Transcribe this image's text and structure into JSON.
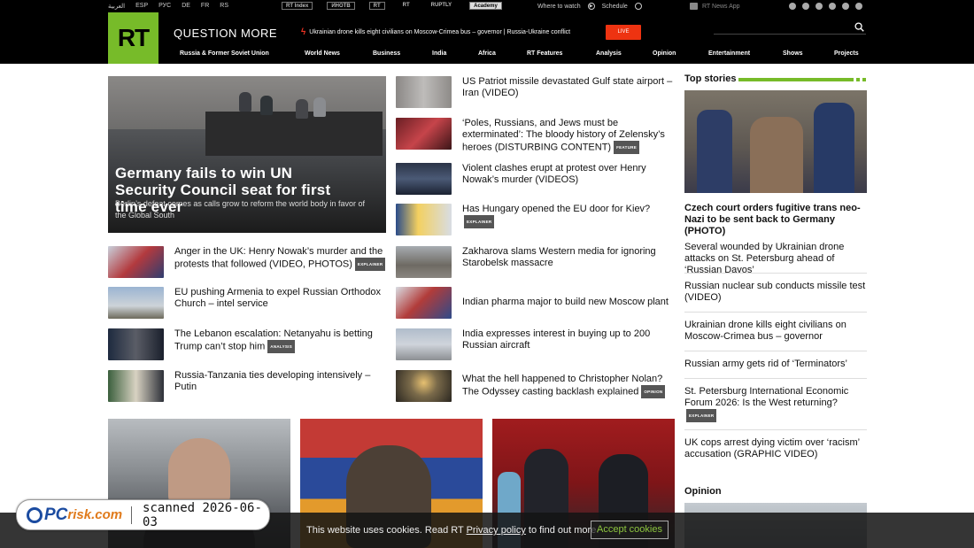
{
  "util": {
    "langs": [
      "العربية",
      "ESP",
      "РУС",
      "DE",
      "FR",
      "RS"
    ],
    "brands": [
      "RT Index",
      "ИНОТВ",
      "RT",
      "RT",
      "RUPTLY",
      "Academy"
    ],
    "where_to_watch": "Where to watch",
    "schedule": "Schedule",
    "app": "RT News App"
  },
  "header": {
    "logo": "RT",
    "slogan": "QUESTION MORE",
    "ticker": "Ukrainian drone kills eight civilians on Moscow-Crimea bus – governor | Russia-Ukraine conflict",
    "live": "LIVE",
    "nav": [
      "Russia & Former Soviet Union",
      "World News",
      "Business",
      "India",
      "Africa",
      "RT Features",
      "Analysis",
      "Opinion",
      "Entertainment",
      "Shows",
      "Projects"
    ]
  },
  "hero": {
    "title": "Germany fails to win UN Security Council seat for first time ever",
    "subtitle": "Berlin’s defeat comes as calls grow to reform the world body in favor of the Global South"
  },
  "left_list": [
    {
      "title": "Anger in the UK: Henry Nowak’s murder and the protests that followed (VIDEO, PHOTOS)",
      "tag": "EXPLAINER"
    },
    {
      "title": "EU pushing Armenia to expel Russian Orthodox Church – intel service",
      "tag": ""
    },
    {
      "title": "The Lebanon escalation: Netanyahu is betting Trump can’t stop him",
      "tag": "ANALYSIS"
    },
    {
      "title": "Russia-Tanzania ties developing intensively – Putin",
      "tag": ""
    }
  ],
  "mid_list": [
    {
      "title": "US Patriot missile devastated Gulf state airport – Iran (VIDEO)",
      "tag": ""
    },
    {
      "title": "‘Poles, Russians, and Jews must be exterminated’: The bloody history of Zelensky’s heroes (DISTURBING CONTENT)",
      "tag": "FEATURE"
    },
    {
      "title": "Violent clashes erupt at protest over Henry Nowak’s murder (VIDEOS)",
      "tag": ""
    },
    {
      "title": "Has Hungary opened the EU door for Kiev?",
      "tag": "EXPLAINER"
    },
    {
      "title": "Zakharova slams Western media for ignoring Starobelsk massacre",
      "tag": ""
    },
    {
      "title": "Indian pharma major to build new Moscow plant",
      "tag": ""
    },
    {
      "title": "India expresses interest in buying up to 200 Russian aircraft",
      "tag": ""
    },
    {
      "title": "What the hell happened to Christopher Nolan? The Odyssey casting backlash explained",
      "tag": "OPINION"
    }
  ],
  "top_stories": {
    "heading": "Top stories",
    "main_title": "Czech court orders fugitive trans neo-Nazi to be sent back to Germany (PHOTO)",
    "items": [
      {
        "title": "Several wounded by Ukrainian drone attacks on St. Petersburg ahead of ‘Russian Davos’",
        "tag": ""
      },
      {
        "title": "Russian nuclear sub conducts missile test (VIDEO)",
        "tag": ""
      },
      {
        "title": "Ukrainian drone kills eight civilians on Moscow-Crimea bus – governor",
        "tag": ""
      },
      {
        "title": "Russian army gets rid of ‘Terminators’",
        "tag": ""
      },
      {
        "title": "St. Petersburg International Economic Forum 2026: Is the West returning?",
        "tag": "EXPLAINER"
      },
      {
        "title": "UK cops arrest dying victim over ‘racism’ accusation (GRAPHIC VIDEO)",
        "tag": ""
      }
    ],
    "opinion_heading": "Opinion"
  },
  "cookie": {
    "text_before": "This website uses cookies. Read RT",
    "link": "Privacy policy",
    "text_after": "to find out more.",
    "button": "Accept cookies"
  },
  "watermark": {
    "logo_pc": "PC",
    "logo_risk": "risk.com",
    "scanned": "scanned 2026-06-03"
  }
}
